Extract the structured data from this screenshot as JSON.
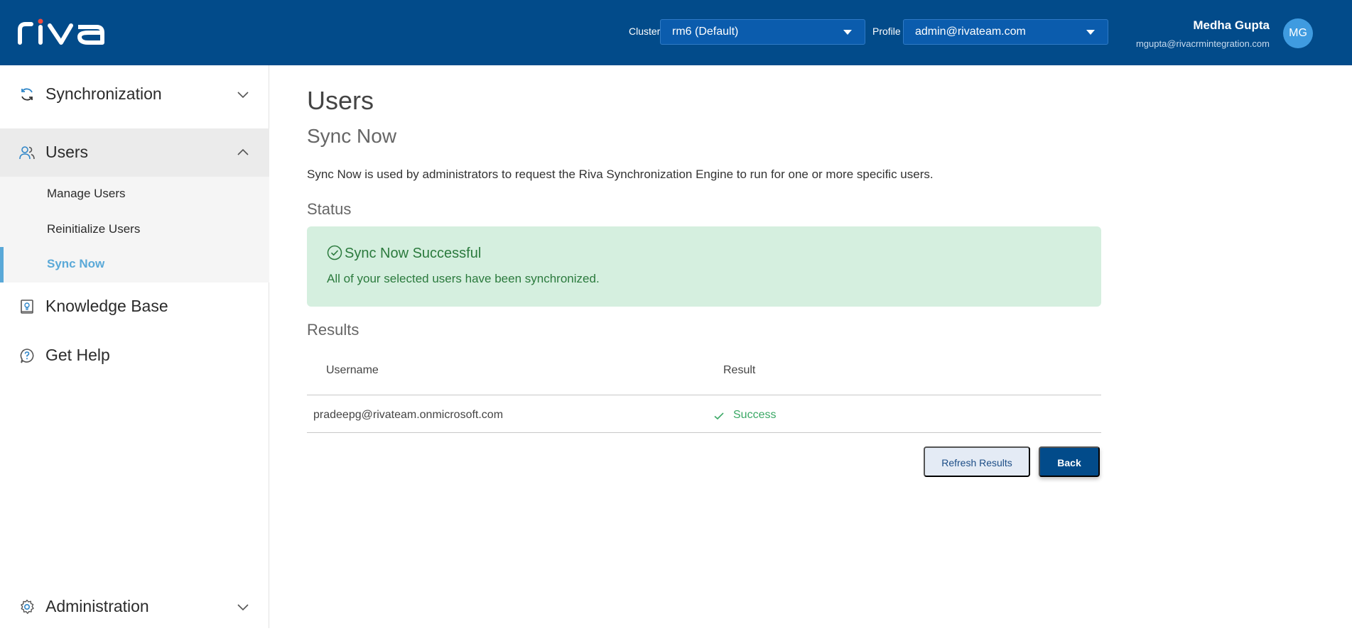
{
  "header": {
    "logo_text": "riva",
    "cluster_label": "Cluster",
    "cluster_value": "rm6 (Default)",
    "profile_label": "Profile",
    "profile_value": "admin@rivateam.com",
    "user_name": "Medha Gupta",
    "user_email": "mgupta@rivacrmintegration.com",
    "avatar_initials": "MG"
  },
  "sidebar": {
    "items": [
      {
        "label": "Synchronization",
        "icon": "sync-icon",
        "expanded": false
      },
      {
        "label": "Users",
        "icon": "users-icon",
        "expanded": true,
        "children": [
          {
            "label": "Manage Users",
            "active": false
          },
          {
            "label": "Reinitialize Users",
            "active": false
          },
          {
            "label": "Sync Now",
            "active": true
          }
        ]
      },
      {
        "label": "Knowledge Base",
        "icon": "book-icon"
      },
      {
        "label": "Get Help",
        "icon": "help-icon"
      },
      {
        "label": "Administration",
        "icon": "gear-icon",
        "expanded": false
      }
    ]
  },
  "main": {
    "title": "Users",
    "subtitle": "Sync Now",
    "description": "Sync Now is used by administrators to request the Riva Synchronization Engine to run for one or more specific users.",
    "status_heading": "Status",
    "alert": {
      "title": "Sync Now Successful",
      "body": "All of your selected users have been synchronized."
    },
    "results_heading": "Results",
    "table": {
      "columns": [
        "Username",
        "Result"
      ],
      "rows": [
        {
          "username": "pradeepg@rivateam.onmicrosoft.com",
          "result": "Success"
        }
      ]
    },
    "buttons": {
      "refresh": "Refresh Results",
      "back": "Back"
    }
  },
  "colors": {
    "header_bg": "#024b8a",
    "accent": "#5aa9d8",
    "success": "#3aa865",
    "alert_bg": "#d5efdf"
  }
}
